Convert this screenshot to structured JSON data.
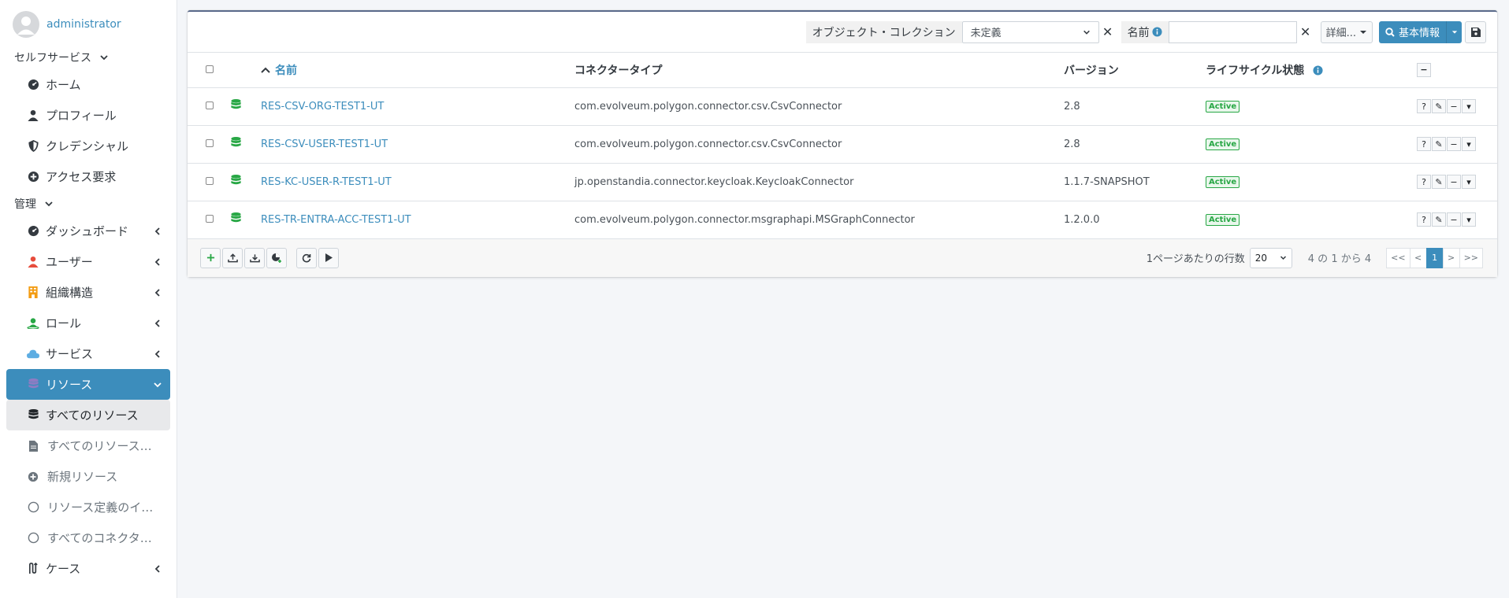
{
  "user": {
    "name": "administrator"
  },
  "sidebar": {
    "self_service": {
      "header": "セルフサービス",
      "items": [
        {
          "label": "ホーム",
          "icon": "dashboard-icon"
        },
        {
          "label": "プロフィール",
          "icon": "user-icon"
        },
        {
          "label": "クレデンシャル",
          "icon": "shield-icon"
        },
        {
          "label": "アクセス要求",
          "icon": "plus-circle-icon"
        }
      ]
    },
    "admin": {
      "header": "管理",
      "items": [
        {
          "label": "ダッシュボード",
          "icon": "dashboard-icon"
        },
        {
          "label": "ユーザー",
          "icon": "user-icon",
          "color": "#e74c3c"
        },
        {
          "label": "組織構造",
          "icon": "building-icon",
          "color": "#f39c12"
        },
        {
          "label": "ロール",
          "icon": "role-icon",
          "color": "#28a745"
        },
        {
          "label": "サービス",
          "icon": "cloud-icon",
          "color": "#5dade2"
        },
        {
          "label": "リソース",
          "icon": "database-icon",
          "color": "#8e7cc3"
        }
      ],
      "resource_sub": [
        {
          "label": "すべてのリソース",
          "icon": "database-icon"
        },
        {
          "label": "すべてのリソース・...",
          "icon": "file-icon"
        },
        {
          "label": "新規リソース",
          "icon": "plus-circle-icon"
        },
        {
          "label": "リソース定義のイン...",
          "icon": "circle-icon"
        },
        {
          "label": "すべてのコネクター...",
          "icon": "circle-icon"
        }
      ],
      "case": {
        "label": "ケース",
        "icon": "case-icon"
      }
    }
  },
  "toolbar": {
    "collection_label": "オブジェクト・コレクション",
    "collection_value": "未定義",
    "name_label": "名前",
    "detail_label": "詳細...",
    "basic_label": "基本情報"
  },
  "table": {
    "headers": {
      "name": "名前",
      "connector": "コネクタータイプ",
      "version": "バージョン",
      "lifecycle": "ライフサイクル状態"
    },
    "rows": [
      {
        "name": "RES-CSV-ORG-TEST1-UT",
        "connector": "com.evolveum.polygon.connector.csv.CsvConnector",
        "version": "2.8",
        "status": "Active"
      },
      {
        "name": "RES-CSV-USER-TEST1-UT",
        "connector": "com.evolveum.polygon.connector.csv.CsvConnector",
        "version": "2.8",
        "status": "Active"
      },
      {
        "name": "RES-KC-USER-R-TEST1-UT",
        "connector": "jp.openstandia.connector.keycloak.KeycloakConnector",
        "version": "1.1.7-SNAPSHOT",
        "status": "Active"
      },
      {
        "name": "RES-TR-ENTRA-ACC-TEST1-UT",
        "connector": "com.evolveum.polygon.connector.msgraphapi.MSGraphConnector",
        "version": "1.2.0.0",
        "status": "Active"
      }
    ]
  },
  "pager": {
    "rows_label": "1ページあたりの行数",
    "rows_value": "20",
    "range": "4 の 1 から 4",
    "buttons": [
      "<<",
      "<",
      "1",
      ">",
      ">>"
    ]
  }
}
